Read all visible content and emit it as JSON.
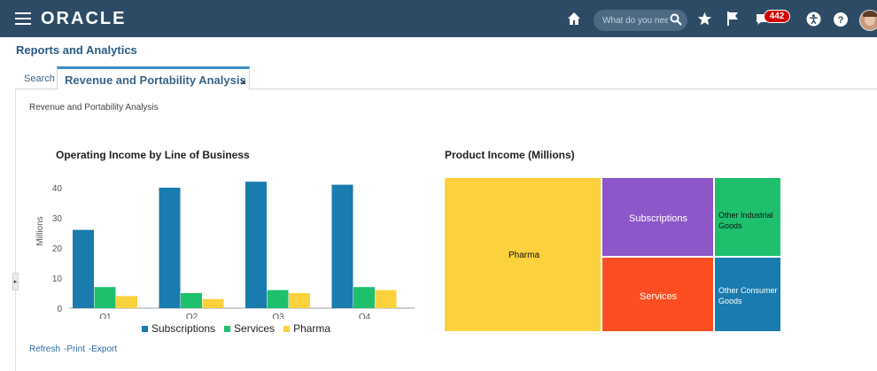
{
  "header": {
    "logo": "ORACLE",
    "search_placeholder": "What do you nee",
    "notification_count": "442",
    "icons": [
      "hamburger-icon",
      "home-icon",
      "search-icon",
      "star-icon",
      "flag-icon",
      "notification-icon",
      "accessibility-icon",
      "help-icon"
    ]
  },
  "page": {
    "title": "Reports and Analytics"
  },
  "tabs": [
    {
      "label": "Search"
    },
    {
      "label": "Revenue and Portability Analysis",
      "close": "×"
    }
  ],
  "report": {
    "crumb": "Revenue and Portability Analysis"
  },
  "chart1": {
    "title": "Operating Income by Line of Business"
  },
  "chart2": {
    "title": "Product Income (Millions)"
  },
  "footer": {
    "refresh": "Refresh",
    "print": "-Print",
    "export": "-Export"
  },
  "chart_data": [
    {
      "type": "bar",
      "title": "Operating Income by Line of Business",
      "categories": [
        "Q1",
        "Q2",
        "Q3",
        "Q4"
      ],
      "ylabel": "Millions",
      "ylim": [
        0,
        45
      ],
      "yticks": [
        0,
        10,
        20,
        30,
        40
      ],
      "grid": false,
      "legend_position": "bottom",
      "series": [
        {
          "name": "Subscriptions",
          "color": "#1a7bae",
          "values": [
            26,
            40,
            42,
            41
          ]
        },
        {
          "name": "Services",
          "color": "#1ec06e",
          "values": [
            7,
            5,
            6,
            7
          ]
        },
        {
          "name": "Pharma",
          "color": "#fbd13e",
          "values": [
            4,
            3,
            5,
            6
          ]
        }
      ]
    },
    {
      "type": "treemap",
      "title": "Product Income (Millions)",
      "nodes": [
        {
          "label": "Pharma",
          "color": "#fbd13e"
        },
        {
          "label": "Subscriptions",
          "color": "#8d56c9"
        },
        {
          "label": "Services",
          "color": "#fc4e21"
        },
        {
          "label": "Other Industrial Goods",
          "color": "#1ec06e"
        },
        {
          "label": "Other Consumer Goods",
          "color": "#1a7bae"
        }
      ]
    }
  ]
}
